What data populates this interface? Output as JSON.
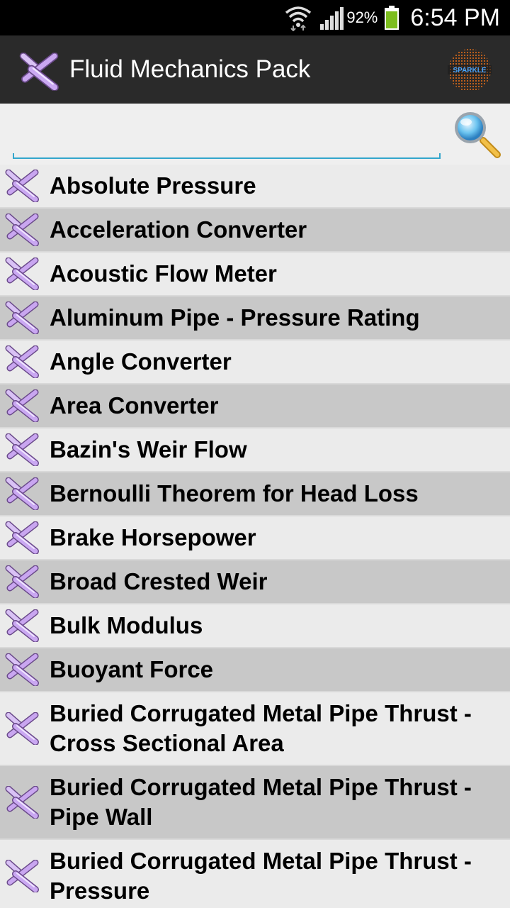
{
  "status_bar": {
    "battery_percent": "92%",
    "time": "6:54 PM"
  },
  "action_bar": {
    "title": "Fluid Mechanics Pack",
    "brand_logo_text": "SPARKLE"
  },
  "search": {
    "value": "",
    "placeholder": ""
  },
  "colors": {
    "accent": "#33a6cc",
    "icon_purple": "#c9a6f0",
    "row_light": "#ebebeb",
    "row_dark": "#c8c8c8",
    "action_bar": "#2a2a2a"
  },
  "list": {
    "items": [
      {
        "label": "Absolute Pressure"
      },
      {
        "label": "Acceleration Converter"
      },
      {
        "label": "Acoustic Flow Meter"
      },
      {
        "label": "Aluminum Pipe - Pressure Rating"
      },
      {
        "label": "Angle Converter"
      },
      {
        "label": "Area Converter"
      },
      {
        "label": "Bazin's Weir Flow"
      },
      {
        "label": "Bernoulli Theorem for Head Loss"
      },
      {
        "label": "Brake Horsepower"
      },
      {
        "label": "Broad Crested Weir"
      },
      {
        "label": "Bulk Modulus"
      },
      {
        "label": "Buoyant Force"
      },
      {
        "label": "Buried Corrugated Metal Pipe Thrust - Cross Sectional Area"
      },
      {
        "label": "Buried Corrugated Metal Pipe Thrust - Pipe Wall"
      },
      {
        "label": "Buried Corrugated Metal Pipe Thrust - Pressure"
      }
    ]
  }
}
